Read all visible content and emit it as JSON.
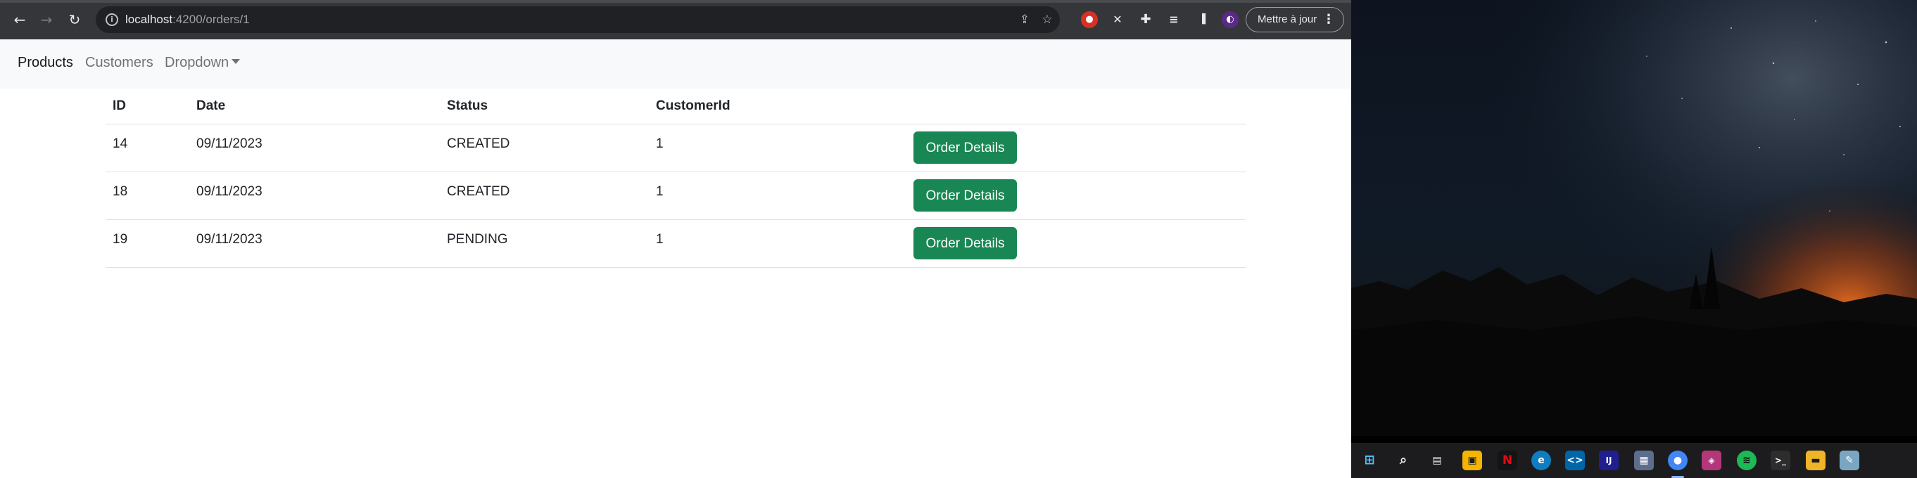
{
  "browser": {
    "url_host": "localhost",
    "url_path": ":4200/orders/1",
    "update_button_label": "Mettre à jour",
    "icons": {
      "back": "arrow-left-icon",
      "forward": "arrow-right-icon",
      "reload": "reload-icon",
      "site_info": "info-icon",
      "share": "share-icon",
      "bookmark": "star-icon",
      "extensions": "puzzle-icon",
      "reading_list": "reading-list-icon",
      "side_panel": "side-panel-icon",
      "menu": "kebab-icon"
    }
  },
  "navbar": {
    "items": [
      {
        "label": "Products"
      },
      {
        "label": "Customers"
      },
      {
        "label": "Dropdown"
      }
    ]
  },
  "table": {
    "headers": [
      "ID",
      "Date",
      "Status",
      "CustomerId",
      ""
    ],
    "rows": [
      {
        "id": "14",
        "date": "09/11/2023",
        "status": "CREATED",
        "customer_id": "1",
        "action": "Order Details"
      },
      {
        "id": "18",
        "date": "09/11/2023",
        "status": "CREATED",
        "customer_id": "1",
        "action": "Order Details"
      },
      {
        "id": "19",
        "date": "09/11/2023",
        "status": "PENDING",
        "customer_id": "1",
        "action": "Order Details"
      }
    ]
  },
  "colors": {
    "button_green": "#198754",
    "navbar_bg": "#f8f9fa",
    "chrome_bar": "#35363a",
    "omnibox_bg": "#202124",
    "taskbar": "#1c1c1e"
  },
  "taskbar": {
    "icons": [
      "windows-start-icon",
      "search-icon",
      "task-view-icon",
      "store-icon",
      "netflix-icon",
      "edge-icon",
      "vscode-icon",
      "intellij-icon",
      "app-icon",
      "chrome-icon",
      "app-icon-2",
      "spotify-icon",
      "terminal-icon",
      "file-explorer-icon",
      "notepad-icon"
    ]
  }
}
